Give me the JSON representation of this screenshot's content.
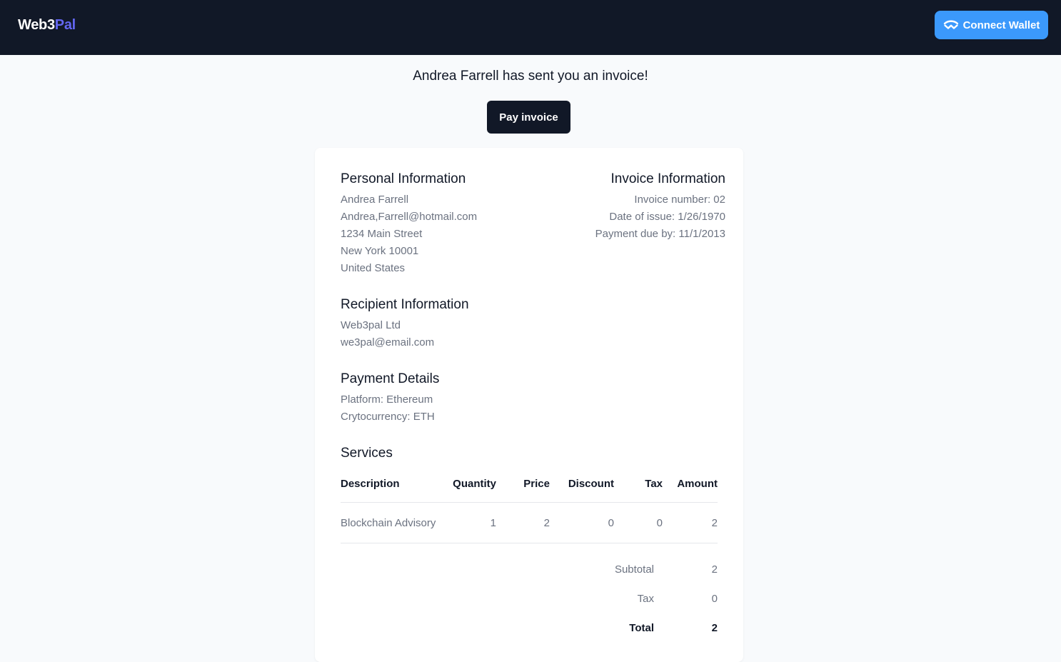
{
  "navbar": {
    "logo_part1": "Web3",
    "logo_part2": "Pal",
    "connect_label": "Connect Wallet",
    "connect_icon": "walletconnect-icon",
    "background": "#111827",
    "accent": "#6366f1",
    "connect_color": "#3b99fc"
  },
  "headline": "Andrea Farrell has sent you an invoice!",
  "pay_label": "Pay invoice",
  "personal": {
    "title": "Personal Information",
    "name": "Andrea Farrell",
    "email": "Andrea,Farrell@hotmail.com",
    "street": "1234 Main Street",
    "city": "New York 10001",
    "country": "United States"
  },
  "invoice": {
    "title": "Invoice Information",
    "number": "Invoice number: 02",
    "issue_date": "Date of issue: 1/26/1970",
    "due_date": "Payment due by: 11/1/2013"
  },
  "recipient": {
    "title": "Recipient Information",
    "name": "Web3pal Ltd",
    "email": "we3pal@email.com"
  },
  "payment": {
    "title": "Payment Details",
    "platform": "Platform: Ethereum",
    "currency": "Crytocurrency: ETH"
  },
  "services": {
    "title": "Services",
    "headers": {
      "description": "Description",
      "quantity": "Quantity",
      "price": "Price",
      "discount": "Discount",
      "tax": "Tax",
      "amount": "Amount"
    },
    "rows": [
      {
        "description": "Blockchain Advisory",
        "quantity": "1",
        "price": "2",
        "discount": "0",
        "tax": "0",
        "amount": "2"
      }
    ]
  },
  "summary": {
    "subtotal_label": "Subtotal",
    "subtotal_value": "2",
    "tax_label": "Tax",
    "tax_value": "0",
    "total_label": "Total",
    "total_value": "2"
  }
}
